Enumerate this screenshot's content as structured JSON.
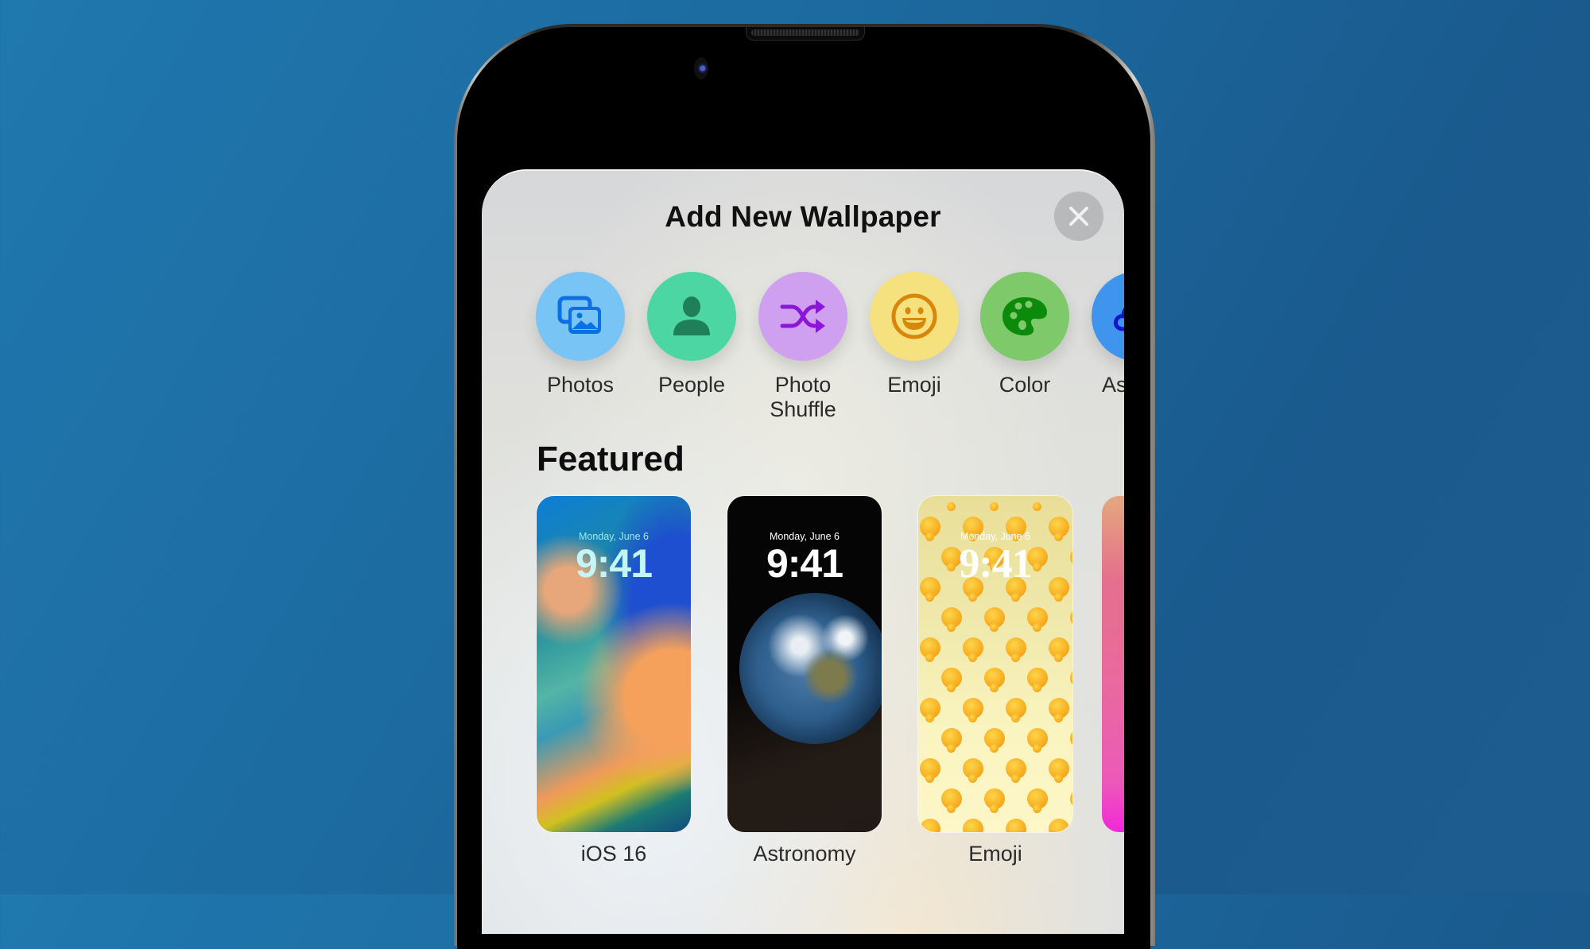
{
  "sheet": {
    "title": "Add New Wallpaper",
    "close_icon": "close-icon"
  },
  "categories": [
    {
      "label": "Photos",
      "icon": "photos-icon",
      "color": "#78c4f4",
      "icon_color": "#0b6fe6"
    },
    {
      "label": "People",
      "icon": "person-icon",
      "color": "#4bd6a3",
      "icon_color": "#1f7f58"
    },
    {
      "label": "Photo",
      "label2": "Shuffle",
      "icon": "shuffle-icon",
      "color": "#cf9ff0",
      "icon_color": "#8a16d8"
    },
    {
      "label": "Emoji",
      "icon": "smiley-icon",
      "color": "#f6e17f",
      "icon_color": "#d8870b"
    },
    {
      "label": "Color",
      "icon": "palette-icon",
      "color": "#7ec96a",
      "icon_color": "#0c8a0c"
    },
    {
      "label": "Ast",
      "icon": "cloud-icon",
      "color": "#3f94ee",
      "icon_color": "#1414c8"
    }
  ],
  "featured": {
    "heading": "Featured",
    "items": [
      {
        "label": "iOS 16",
        "date": "Monday, June 6",
        "time": "9:41"
      },
      {
        "label": "Astronomy",
        "date": "Monday, June 6",
        "time": "9:41"
      },
      {
        "label": "Emoji",
        "date": "Monday, June 6",
        "time": "9:41"
      },
      {
        "label": "",
        "date": "",
        "time": ""
      }
    ]
  }
}
